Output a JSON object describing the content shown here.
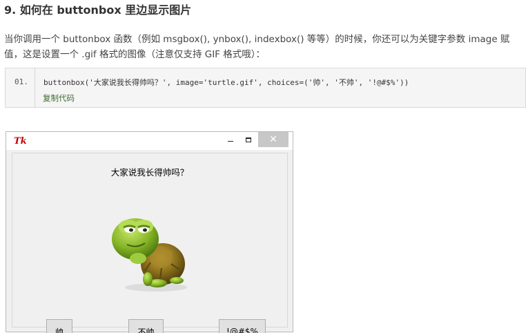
{
  "article": {
    "heading": "9. 如何在 buttonbox 里边显示图片",
    "paragraph": "当你调用一个 buttonbox 函数（例如 msgbox(), ynbox(), indexbox() 等等）的时候，你还可以为关键字参数 image 赋值，这是设置一个 .gif 格式的图像（注意仅支持 GIF 格式哦）：",
    "code": {
      "line_number": "01.",
      "line": "buttonbox('大家说我长得帅吗？', image='turtle.gif', choices=('帅', '不帅', '!@#$%'))",
      "copy_label": "复制代码"
    }
  },
  "window": {
    "app_icon": "tk-feather-icon",
    "icon_label": "Tk",
    "controls": {
      "minimize": "minimize-icon",
      "maximize": "maximize-icon",
      "close": "✕"
    },
    "message": "大家说我长得帅吗？",
    "image": "turtle-image",
    "choices": [
      "帅",
      "不帅",
      "!@#$%"
    ]
  },
  "colors": {
    "link_green": "#3c6d2e",
    "close_button_bg": "#c7c7c7",
    "window_bg": "#f0f0f0",
    "code_bg": "#f5f5f5"
  }
}
